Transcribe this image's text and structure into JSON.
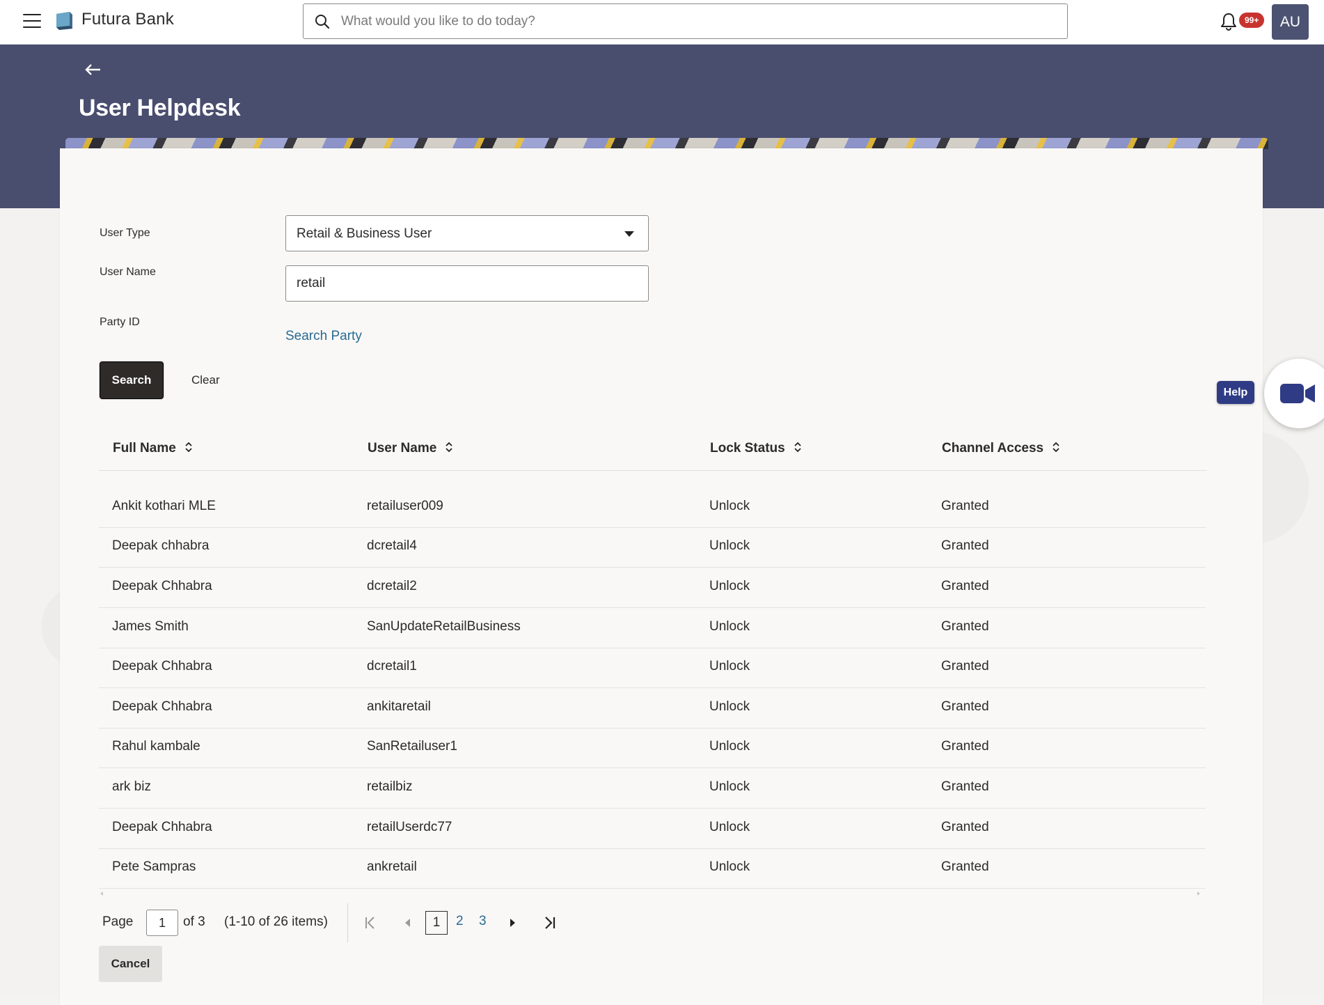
{
  "header": {
    "brand": "Futura Bank",
    "search_placeholder": "What would you like to do today?",
    "notification_badge": "99+",
    "avatar_initials": "AU"
  },
  "page": {
    "title": "User Helpdesk"
  },
  "form": {
    "user_type_label": "User Type",
    "user_type_value": "Retail & Business User",
    "user_name_label": "User Name",
    "user_name_value": "retail",
    "party_id_label": "Party ID",
    "search_party_link": "Search Party",
    "search_button": "Search",
    "clear_button": "Clear"
  },
  "table": {
    "columns": [
      "Full Name",
      "User Name",
      "Lock Status",
      "Channel Access"
    ],
    "rows": [
      {
        "full_name": "Ankit kothari MLE",
        "user_name": "retailuser009",
        "lock_status": "Unlock",
        "channel_access": "Granted"
      },
      {
        "full_name": "Deepak chhabra",
        "user_name": "dcretail4",
        "lock_status": "Unlock",
        "channel_access": "Granted"
      },
      {
        "full_name": "Deepak Chhabra",
        "user_name": "dcretail2",
        "lock_status": "Unlock",
        "channel_access": "Granted"
      },
      {
        "full_name": "James Smith",
        "user_name": "SanUpdateRetailBusiness",
        "lock_status": "Unlock",
        "channel_access": "Granted"
      },
      {
        "full_name": "Deepak Chhabra",
        "user_name": "dcretail1",
        "lock_status": "Unlock",
        "channel_access": "Granted"
      },
      {
        "full_name": "Deepak Chhabra",
        "user_name": "ankitaretail",
        "lock_status": "Unlock",
        "channel_access": "Granted"
      },
      {
        "full_name": "Rahul kambale",
        "user_name": "SanRetailuser1",
        "lock_status": "Unlock",
        "channel_access": "Granted"
      },
      {
        "full_name": "ark biz",
        "user_name": "retailbiz",
        "lock_status": "Unlock",
        "channel_access": "Granted"
      },
      {
        "full_name": "Deepak Chhabra",
        "user_name": "retailUserdc77",
        "lock_status": "Unlock",
        "channel_access": "Granted"
      },
      {
        "full_name": "Pete Sampras",
        "user_name": "ankretail",
        "lock_status": "Unlock",
        "channel_access": "Granted"
      }
    ]
  },
  "pagination": {
    "page_label": "Page",
    "current_page": "1",
    "of_label": "of 3",
    "items_summary": "(1-10 of 26 items)",
    "pages": [
      "1",
      "2",
      "3"
    ]
  },
  "footer": {
    "cancel_button": "Cancel"
  },
  "help": {
    "label": "Help"
  },
  "colors": {
    "hero_bg": "#494d6e",
    "link": "#2a6a93",
    "primary_button": "#2e2b28",
    "badge": "#c7342f",
    "help_tag": "#2f3b85"
  }
}
